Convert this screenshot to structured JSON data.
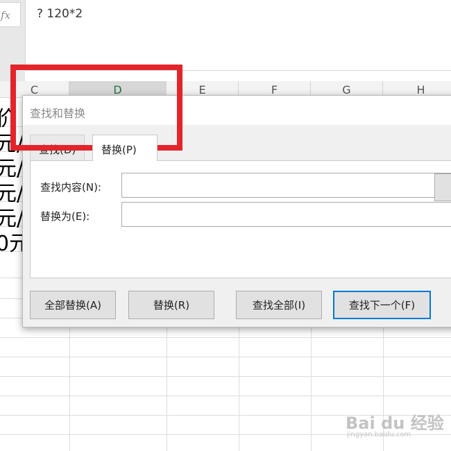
{
  "formula_bar": {
    "fx_label": "fx",
    "content": "? 120*2"
  },
  "columns": [
    "C",
    "D",
    "E",
    "F",
    "G",
    "H"
  ],
  "selected_column": "D",
  "cells": [
    "价",
    "元/",
    "元/",
    "元/",
    "元/",
    "0元"
  ],
  "dialog": {
    "title": "查找和替换",
    "tabs": {
      "find": "查找(D)",
      "replace": "替换(P)"
    },
    "find_what_label": "查找内容(N):",
    "find_what_value": "",
    "replace_with_label": "替换为(E):",
    "replace_with_value": "",
    "buttons": {
      "replace_all": "全部替换(A)",
      "replace": "替换(R)",
      "find_all": "查找全部(I)",
      "find_next": "查找下一个(F)"
    }
  },
  "watermark": {
    "logo_text": "Bai du 经验",
    "url": "jingyan.baidu.com"
  },
  "colors": {
    "highlight": "#e3242b",
    "primary_border": "#0078d7",
    "selected_header_text": "#217346"
  }
}
